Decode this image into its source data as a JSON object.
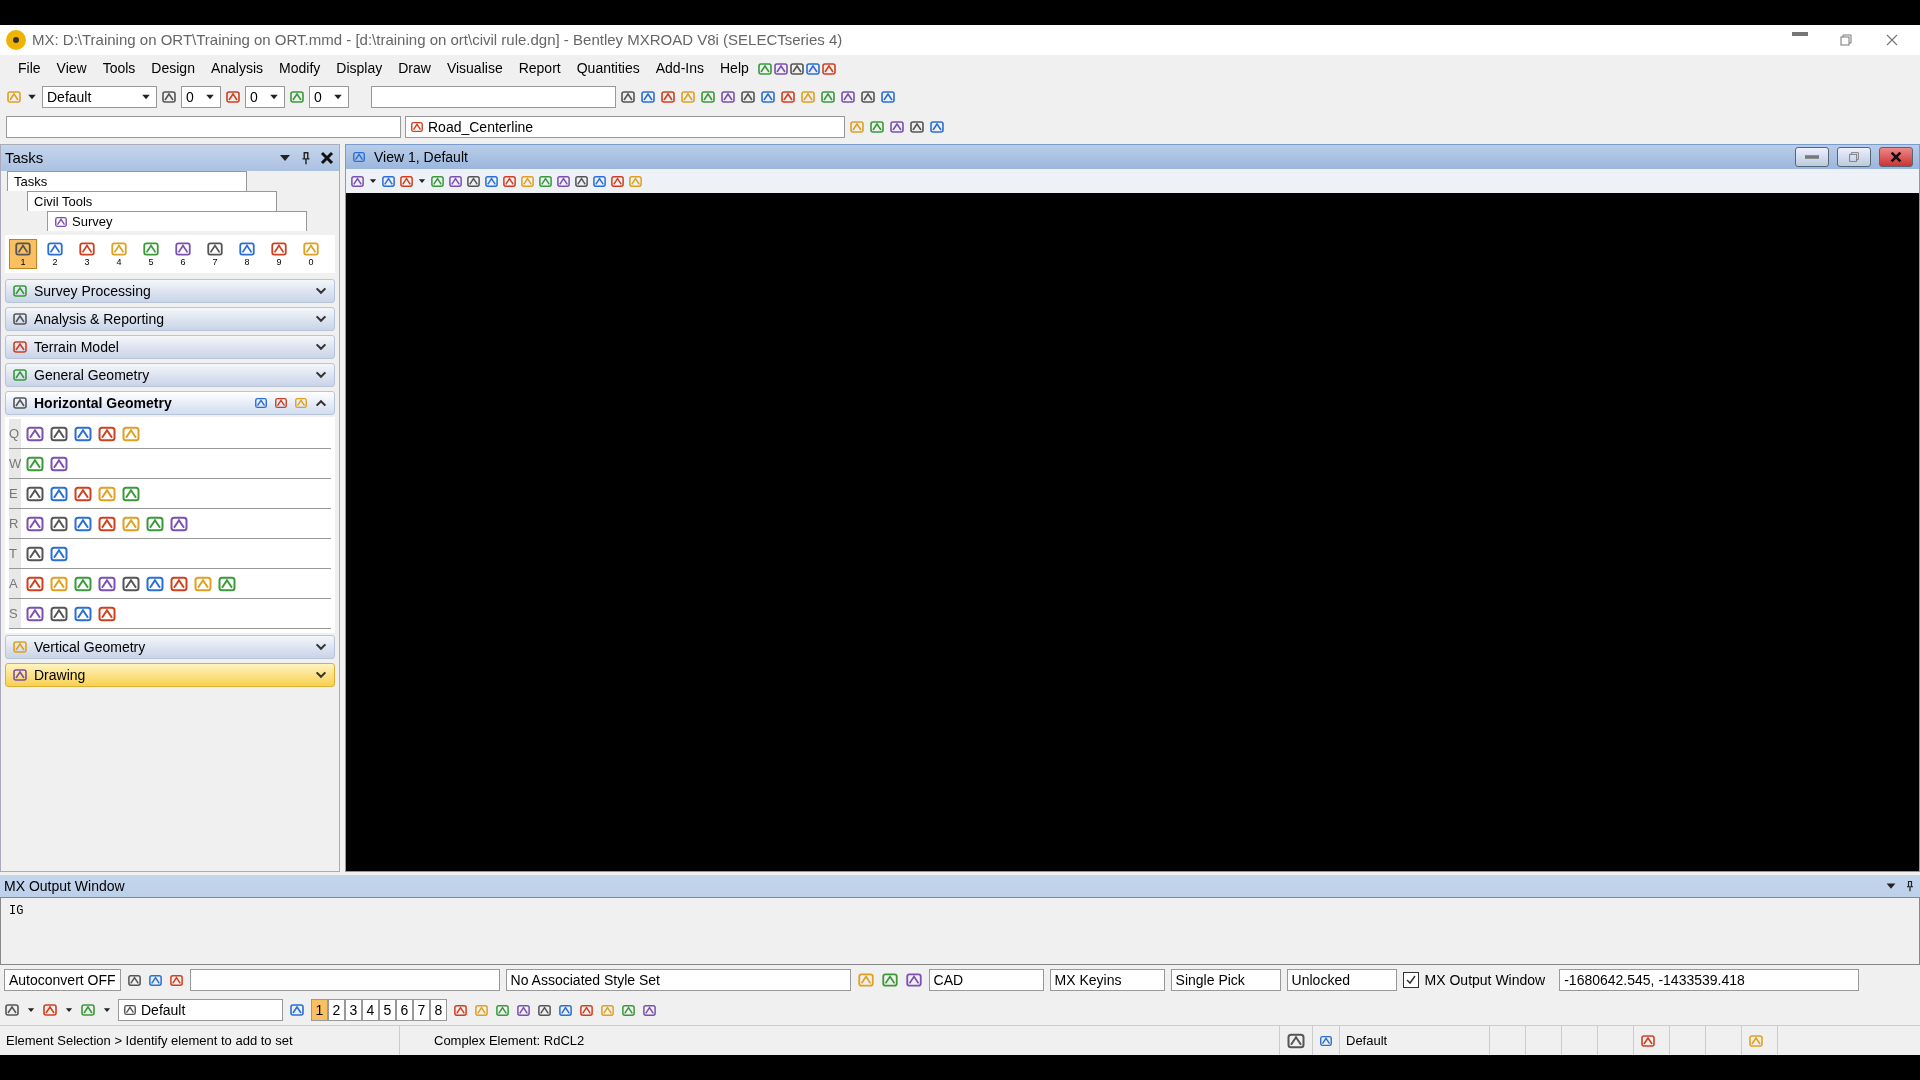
{
  "title_bar": {
    "title": "MX: D:\\Training on ORT\\Training on ORT.mmd - [d:\\training on ort\\civil rule.dgn] - Bentley MXROAD V8i (SELECTseries 4)"
  },
  "menu": [
    "File",
    "View",
    "Tools",
    "Design",
    "Analysis",
    "Modify",
    "Display",
    "Draw",
    "Visualise",
    "Report",
    "Quantities",
    "Add-Ins",
    "Help"
  ],
  "toolbar_1": {
    "style": "Default",
    "counts": [
      "0",
      "0",
      "0"
    ]
  },
  "toolbar_2": {
    "feature": "Road_Centerline"
  },
  "tasks_panel": {
    "title": "Tasks",
    "breadcrumb": [
      "Tasks",
      "Civil Tools",
      "Survey"
    ],
    "tools": [
      {
        "label": "1",
        "selected": true
      },
      {
        "label": "2",
        "selected": false
      },
      {
        "label": "3",
        "selected": false
      },
      {
        "label": "4",
        "selected": false
      },
      {
        "label": "5",
        "selected": false
      },
      {
        "label": "6",
        "selected": false
      },
      {
        "label": "7",
        "selected": false
      },
      {
        "label": "8",
        "selected": false
      },
      {
        "label": "9",
        "selected": false
      },
      {
        "label": "0",
        "selected": false
      }
    ],
    "sections": [
      {
        "label": "Survey Processing",
        "expanded": false,
        "highlighted": false
      },
      {
        "label": "Analysis & Reporting",
        "expanded": false,
        "highlighted": false
      },
      {
        "label": "Terrain Model",
        "expanded": false,
        "highlighted": false
      },
      {
        "label": "General Geometry",
        "expanded": false,
        "highlighted": false
      },
      {
        "label": "Horizontal Geometry",
        "expanded": true,
        "highlighted": false,
        "rows": [
          "Q",
          "W",
          "E",
          "R",
          "T",
          "A",
          "S"
        ]
      },
      {
        "label": "Vertical Geometry",
        "expanded": false,
        "highlighted": false
      },
      {
        "label": "Drawing",
        "expanded": false,
        "highlighted": true
      }
    ]
  },
  "view": {
    "title": "View 1, Default"
  },
  "output_window": {
    "title": "MX Output Window",
    "text": "IG"
  },
  "command_bar": {
    "autoconvert": "Autoconvert OFF",
    "style_set": "No Associated Style Set",
    "dropdowns": [
      "CAD",
      "MX Keyins",
      "Single Pick",
      "Unlocked"
    ],
    "output_toggle": {
      "label": "MX Output Window",
      "checked": true
    },
    "coordinates": "-1680642.545, -1433539.418"
  },
  "view_toolbar": {
    "view_group": "Default",
    "views": [
      {
        "label": "1",
        "selected": true
      },
      {
        "label": "2",
        "selected": false
      },
      {
        "label": "3",
        "selected": false
      },
      {
        "label": "4",
        "selected": false
      },
      {
        "label": "5",
        "selected": false
      },
      {
        "label": "6",
        "selected": false
      },
      {
        "label": "7",
        "selected": false
      },
      {
        "label": "8",
        "selected": false
      }
    ]
  },
  "status_bar": {
    "prompt": "Element Selection > Identify element to add to set",
    "message": "Complex Element: RdCL2",
    "level": "Default"
  }
}
